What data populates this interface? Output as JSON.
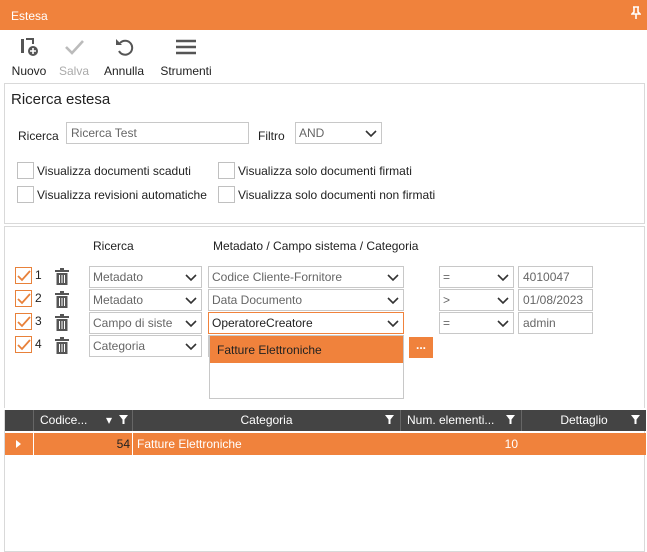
{
  "window": {
    "title": "Estesa",
    "pin_icon": "pin-icon"
  },
  "toolbar": {
    "new_label": "Nuovo",
    "save_label": "Salva",
    "undo_label": "Annulla",
    "tools_label": "Strumenti"
  },
  "search": {
    "section_title": "Ricerca estesa",
    "search_label": "Ricerca",
    "search_value": "Ricerca Test",
    "filter_label": "Filtro",
    "filter_value": "AND",
    "options": [
      {
        "label": "Visualizza documenti scaduti",
        "checked": false
      },
      {
        "label": "Visualizza solo documenti firmati",
        "checked": false
      },
      {
        "label": "Visualizza revisioni automatiche",
        "checked": false
      },
      {
        "label": "Visualizza solo documenti non firmati",
        "checked": false
      }
    ]
  },
  "criteria": {
    "col_search": "Ricerca",
    "col_field": "Metadato / Campo sistema / Categoria",
    "rows": [
      {
        "num": "1",
        "type": "Metadato",
        "field": "Codice Cliente-Fornitore",
        "op": "=",
        "value": "4010047",
        "checked": true
      },
      {
        "num": "2",
        "type": "Metadato",
        "field": "Data Documento",
        "op": ">",
        "value": "01/08/2023",
        "checked": true
      },
      {
        "num": "3",
        "type": "Campo di siste",
        "field": "OperatoreCreatore",
        "op": "=",
        "value": "admin",
        "checked": true
      },
      {
        "num": "4",
        "type": "Categoria",
        "field": "",
        "op": "",
        "value": "",
        "checked": true
      }
    ],
    "dropdown_option": "Fatture Elettroniche",
    "more_button": "..."
  },
  "results": {
    "headers": [
      "Codice...",
      "Categoria",
      "Num. elementi...",
      "Dettaglio"
    ],
    "rows": [
      {
        "code": "54",
        "category": "Fatture Elettroniche",
        "count": "10",
        "detail": ""
      }
    ]
  },
  "colors": {
    "accent": "#f0823c",
    "header": "#444444"
  }
}
